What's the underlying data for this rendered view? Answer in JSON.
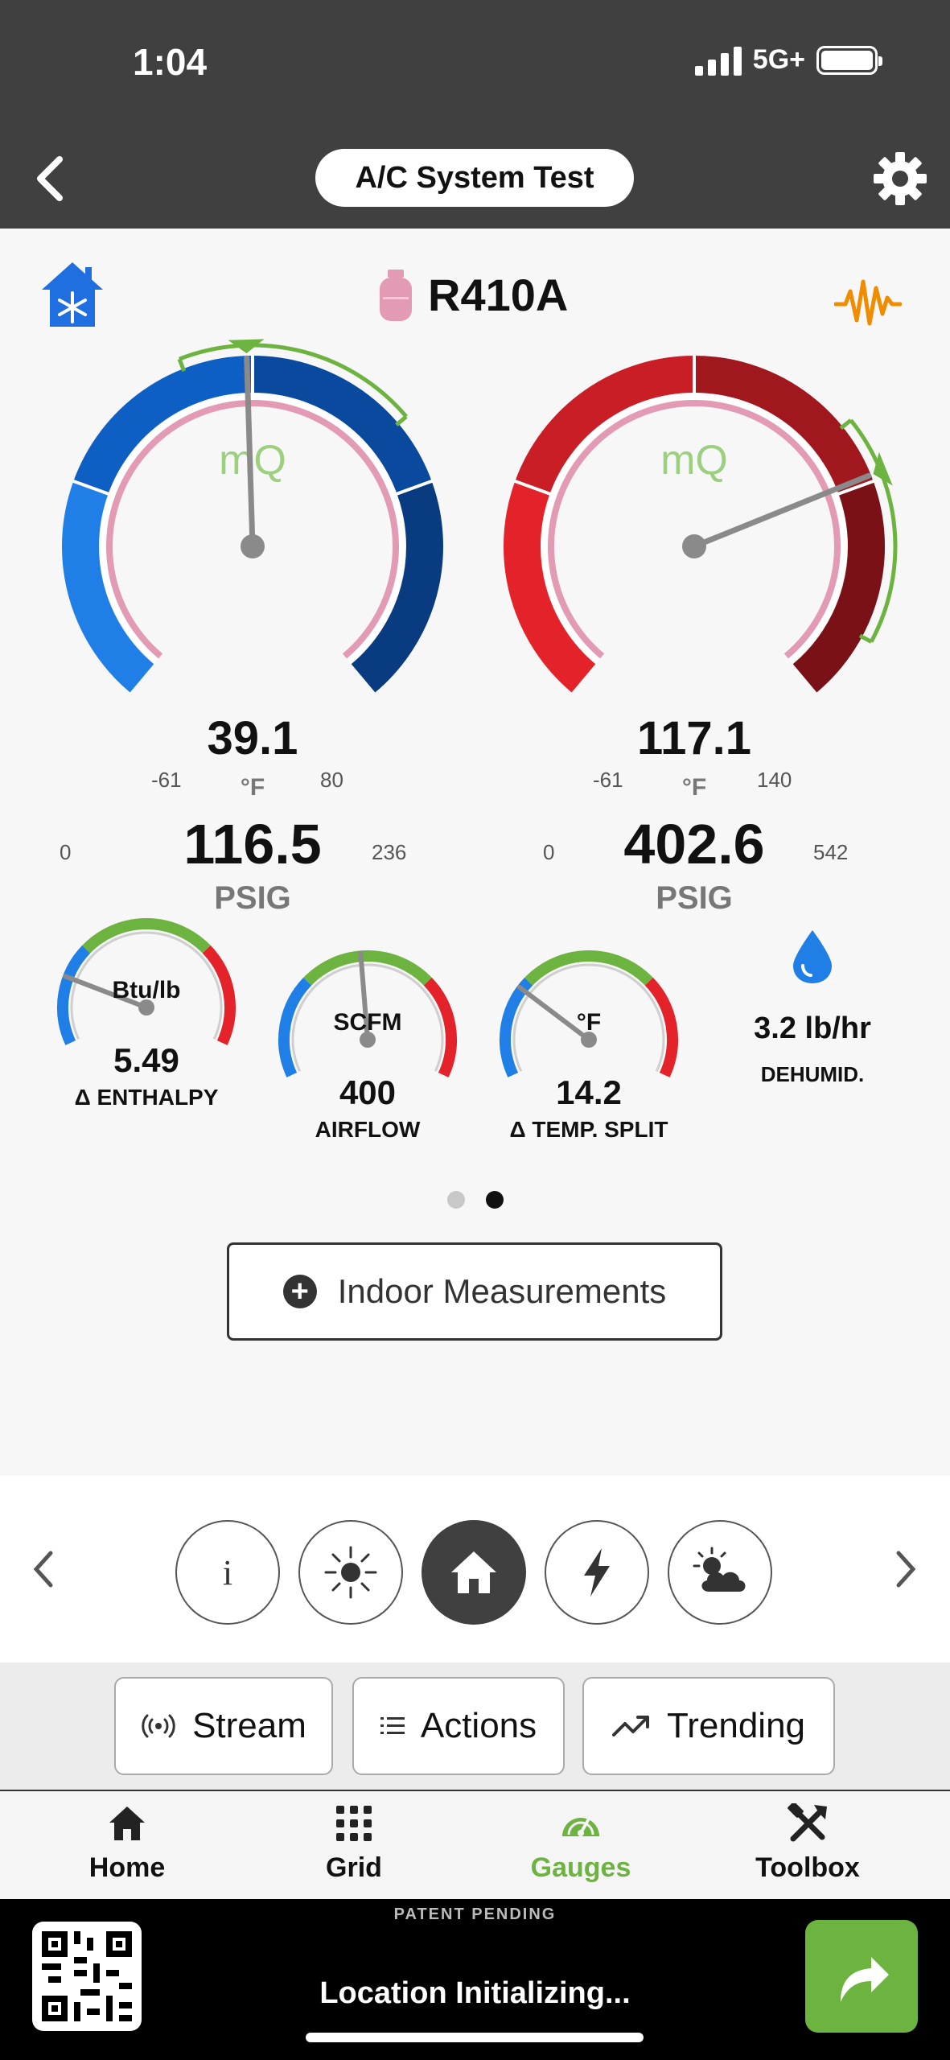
{
  "status_bar": {
    "time": "1:04",
    "network": "5G+"
  },
  "header": {
    "title": "A/C System Test"
  },
  "refrigerant": "R410A",
  "gauges": [
    {
      "name": "suction",
      "temperature": "39.1",
      "temp_unit": "°F",
      "pressure": "116.5",
      "pressure_unit": "PSIG",
      "pressure_min": "0",
      "pressure_max": "236",
      "temp_min": "-61",
      "temp_max": "80",
      "pressure_value": 116.5,
      "target_band": [
        100,
        160
      ],
      "colors": [
        "#1f7fe6",
        "#0d5fc3",
        "#0a4a9e",
        "#083b80"
      ]
    },
    {
      "name": "discharge",
      "temperature": "117.1",
      "temp_unit": "°F",
      "pressure": "402.6",
      "pressure_unit": "PSIG",
      "pressure_min": "0",
      "pressure_max": "542",
      "temp_min": "-61",
      "temp_max": "140",
      "pressure_value": 402.6,
      "target_band": [
        370,
        500
      ],
      "colors": [
        "#e3222a",
        "#c91e26",
        "#a0171e",
        "#7a1116"
      ]
    }
  ],
  "mini_gauges": [
    {
      "unit": "Btu/lb",
      "value": "5.49",
      "label": "Δ ENTHALPY",
      "needle_fraction": 0.2
    },
    {
      "unit": "SCFM",
      "value": "400",
      "label": "AIRFLOW",
      "needle_fraction": 0.48
    },
    {
      "unit": "°F",
      "value": "14.2",
      "label": "Δ TEMP. SPLIT",
      "needle_fraction": 0.27
    }
  ],
  "dehumidification": {
    "value": "3.2 lb/hr",
    "label": "DEHUMID."
  },
  "pager": {
    "pages": 2,
    "active": 1
  },
  "indoor_button": {
    "label": "Indoor Measurements"
  },
  "carousel": {
    "buttons": [
      "info-icon",
      "sun-icon",
      "house-icon",
      "lightning-icon",
      "partly-cloudy-icon"
    ],
    "active": 2
  },
  "actions": {
    "stream": "Stream",
    "actions": "Actions",
    "trending": "Trending"
  },
  "tabs": [
    {
      "label": "Home",
      "icon": "home-icon"
    },
    {
      "label": "Grid",
      "icon": "grid-icon"
    },
    {
      "label": "Gauges",
      "icon": "gauge-icon"
    },
    {
      "label": "Toolbox",
      "icon": "toolbox-icon"
    }
  ],
  "active_tab": 2,
  "footer": {
    "patent": "PATENT PENDING",
    "location": "Location Initializing..."
  },
  "accent_colors": {
    "green": "#6db33f",
    "orange": "#f08c00",
    "pink": "#e39ab4",
    "blue": "#1f6fe0"
  }
}
